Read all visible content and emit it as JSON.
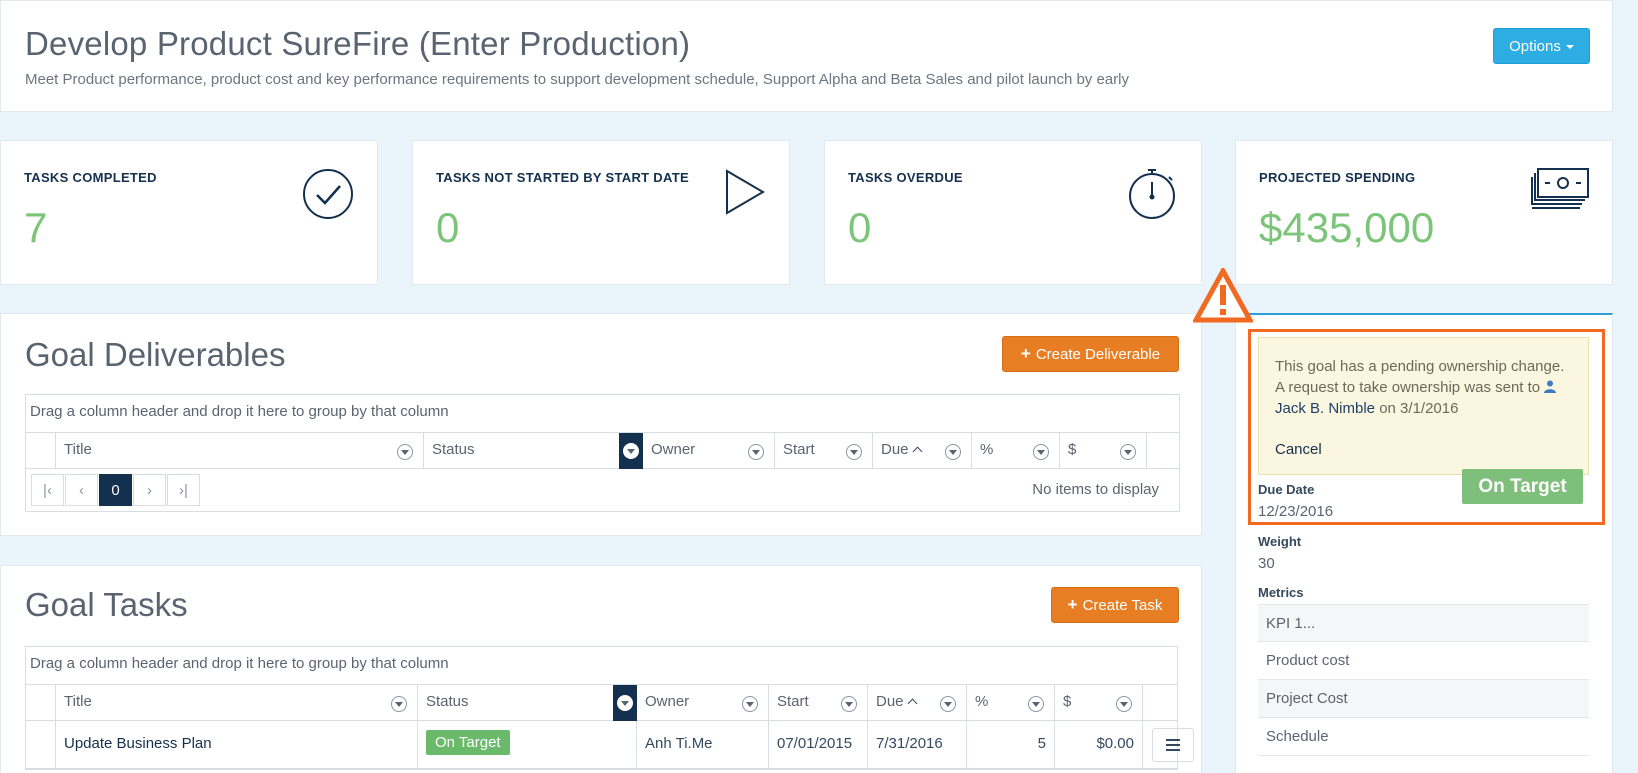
{
  "header": {
    "title": "Develop Product SureFire (Enter Production)",
    "subtitle": "Meet Product performance, product cost and key performance requirements to support development schedule, Support Alpha and Beta Sales and pilot launch by early",
    "options_label": "Options"
  },
  "stats": [
    {
      "label": "TASKS COMPLETED",
      "value": "7",
      "icon": "check-circle-icon"
    },
    {
      "label": "TASKS NOT STARTED BY START DATE",
      "value": "0",
      "icon": "play-icon"
    },
    {
      "label": "TASKS OVERDUE",
      "value": "0",
      "icon": "stopwatch-icon"
    },
    {
      "label": "PROJECTED SPENDING",
      "value": "$435,000",
      "icon": "money-stack-icon"
    }
  ],
  "deliverables": {
    "title": "Goal Deliverables",
    "create_label": "Create Deliverable",
    "group_hint": "Drag a column header and drop it here to group by that column",
    "columns": [
      "Title",
      "Status",
      "Owner",
      "Start",
      "Due",
      "%",
      "$"
    ],
    "pager_current": "0",
    "empty_text": "No items to display"
  },
  "tasks": {
    "title": "Goal Tasks",
    "create_label": "Create Task",
    "group_hint": "Drag a column header and drop it here to group by that column",
    "columns": [
      "Title",
      "Status",
      "Owner",
      "Start",
      "Due",
      "%",
      "$"
    ],
    "rows": [
      {
        "title": "Update Business Plan",
        "status": "On Target",
        "owner": "Anh Ti.Me",
        "start": "07/01/2015",
        "due": "7/31/2016",
        "pct": "5",
        "cost": "$0.00"
      }
    ]
  },
  "sidebar": {
    "alert_text": "This goal has a pending ownership change. A request to take ownership was sent to",
    "alert_user": "Jack B. Nimble",
    "alert_date": "on 3/1/2016",
    "alert_cancel": "Cancel",
    "status": "On Target",
    "due_date_label": "Due Date",
    "due_date": "12/23/2016",
    "weight_label": "Weight",
    "weight": "30",
    "metrics_label": "Metrics",
    "metrics": [
      "KPI 1...",
      "Product cost",
      "Project Cost",
      "Schedule"
    ]
  },
  "colors": {
    "accent_blue": "#2dade2",
    "orange": "#e87e23",
    "highlight": "#f26a21",
    "green": "#7cc47a",
    "navy": "#14304f"
  }
}
